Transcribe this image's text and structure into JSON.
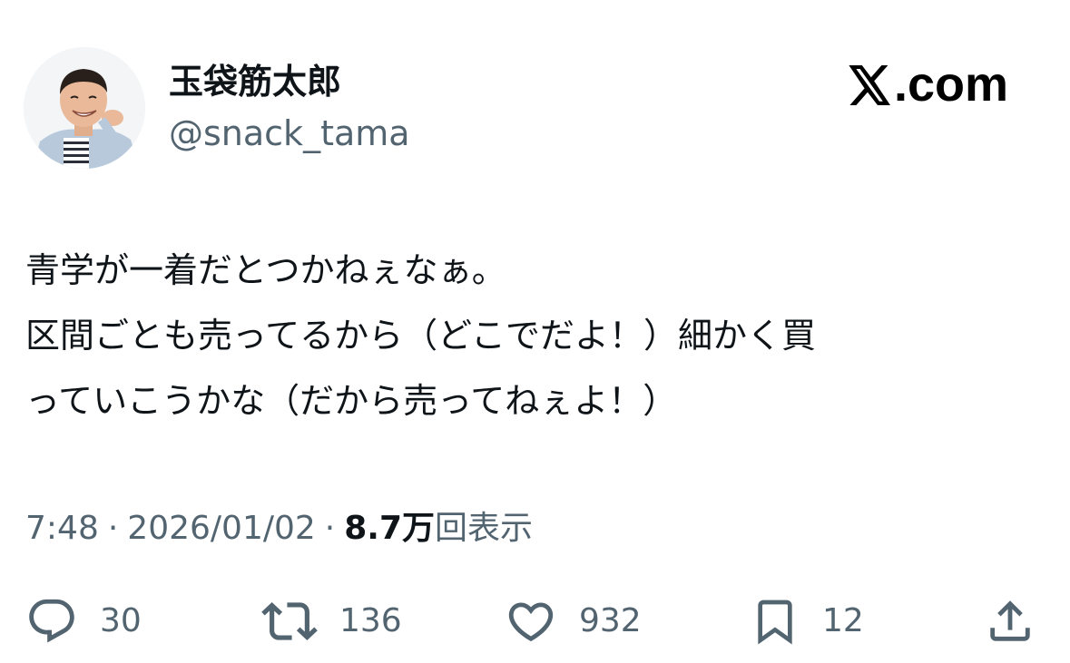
{
  "author": {
    "display_name": "玉袋筋太郎",
    "handle": "@snack_tama",
    "avatar_icon": "user-avatar-photo"
  },
  "brand": {
    "logo_icon": "x-logo-icon",
    "domain": ".com"
  },
  "tweet": {
    "lines": [
      "青学が一着だとつかねぇなぁ。",
      "区間ごとも売ってるから（どこでだよ！）細かく買",
      "っていこうかな（だから売ってねぇよ！）"
    ]
  },
  "meta": {
    "time": "7:48",
    "separator": "·",
    "date": "2026/01/02",
    "views_count": "8.7万",
    "views_label": "回表示"
  },
  "actions": {
    "reply": {
      "icon": "reply-icon",
      "count": "30"
    },
    "retweet": {
      "icon": "retweet-icon",
      "count": "136"
    },
    "like": {
      "icon": "heart-icon",
      "count": "932"
    },
    "bookmark": {
      "icon": "bookmark-icon",
      "count": "12"
    },
    "share": {
      "icon": "share-icon"
    }
  },
  "colors": {
    "text_primary": "#0f1419",
    "text_secondary": "#536471",
    "icon": "#536471",
    "background": "#ffffff"
  }
}
